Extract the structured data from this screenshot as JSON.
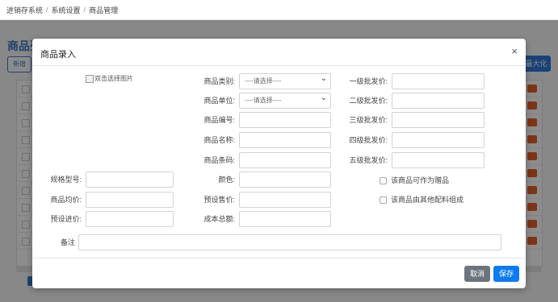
{
  "breadcrumb": [
    "进销存系统",
    "系统设置",
    "商品管理"
  ],
  "background": {
    "page_title": "商品列",
    "new_button": "新增",
    "maximize_button": "最大化"
  },
  "modal": {
    "title": "商品录入",
    "close_glyph": "×",
    "image_placeholder": "双击选择图片",
    "category": {
      "label": "商品类别:",
      "value": "----请选择----"
    },
    "unit": {
      "label": "商品单位:",
      "value": "----请选择----"
    },
    "code": {
      "label": "商品编号:",
      "value": ""
    },
    "name": {
      "label": "商品名称:",
      "value": ""
    },
    "barcode": {
      "label": "商品条码:",
      "value": ""
    },
    "spec": {
      "label": "规格型号:",
      "value": ""
    },
    "color": {
      "label": "颜色:",
      "value": ""
    },
    "avg_price": {
      "label": "商品均价:",
      "value": ""
    },
    "preset_sale_price": {
      "label": "预设售价:",
      "value": ""
    },
    "preset_purchase_price": {
      "label": "预设进价:",
      "value": ""
    },
    "total_cost": {
      "label": "成本总额:",
      "value": ""
    },
    "wholesale_1": {
      "label": "一级批发价:",
      "value": ""
    },
    "wholesale_2": {
      "label": "二级批发价:",
      "value": ""
    },
    "wholesale_3": {
      "label": "三级批发价:",
      "value": ""
    },
    "wholesale_4": {
      "label": "四级批发价:",
      "value": ""
    },
    "wholesale_5": {
      "label": "五级批发价:",
      "value": ""
    },
    "checkbox_gift": {
      "label": "该商品可作为赠品",
      "checked": false
    },
    "checkbox_composite": {
      "label": "该商品由其他配料组成",
      "checked": false
    },
    "remark": {
      "label": "备注",
      "value": ""
    },
    "cancel_button": "取消",
    "save_button": "保存"
  },
  "colors": {
    "primary": "#0d7bf0",
    "secondary": "#6c757d",
    "brand": "#3a78c4"
  }
}
